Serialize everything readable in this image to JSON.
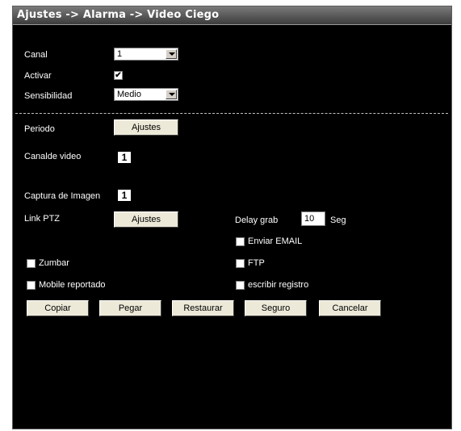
{
  "title": "Ajustes -> Alarma -> Video Ciego",
  "canal": {
    "label": "Canal",
    "value": "1"
  },
  "activar": {
    "label": "Activar",
    "checked": true
  },
  "sensibilidad": {
    "label": "Sensibilidad",
    "value": "Medio"
  },
  "periodo": {
    "label": "Periodo",
    "button": "Ajustes"
  },
  "canal_video": {
    "label": "Canalde video",
    "value": "1"
  },
  "captura": {
    "label": "Captura de Imagen",
    "value": "1"
  },
  "link_ptz": {
    "label": "Link PTZ",
    "button": "Ajustes"
  },
  "delay": {
    "label": "Delay grab",
    "value": "10",
    "unit": "Seg"
  },
  "enviar_email": {
    "label": "Enviar EMAIL",
    "checked": false
  },
  "zumbar": {
    "label": "Zumbar",
    "checked": false
  },
  "ftp": {
    "label": "FTP",
    "checked": false
  },
  "mobile": {
    "label": "Mobile reportado",
    "checked": false
  },
  "escribir": {
    "label": "escribir registro",
    "checked": false
  },
  "buttons": {
    "copiar": "Copiar",
    "pegar": "Pegar",
    "restaurar": "Restaurar",
    "seguro": "Seguro",
    "cancelar": "Cancelar"
  }
}
